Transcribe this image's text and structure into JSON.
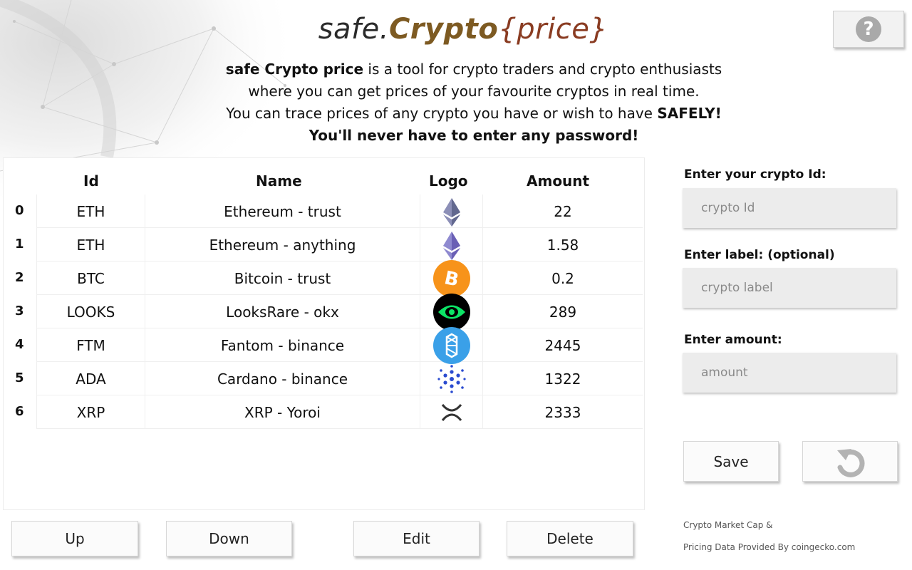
{
  "app": {
    "title_part1": "safe.",
    "title_part2": "Crypto",
    "title_part3": "{price}"
  },
  "intro": {
    "line1_bold": "safe Crypto price",
    "line1_rest": " is a tool for crypto traders and crypto enthusiasts",
    "line2": "where you can get prices of your favourite cryptos in real time.",
    "line3_rest": "You can trace prices of any crypto you have or wish to have ",
    "line3_bold": "SAFELY!",
    "line4": "You'll never have to enter any password!"
  },
  "help_button": {
    "label": "?"
  },
  "table": {
    "headers": {
      "id": "Id",
      "name": "Name",
      "logo": "Logo",
      "amount": "Amount"
    },
    "rows": [
      {
        "index": "0",
        "id": "ETH",
        "name": "Ethereum - trust",
        "logo": "ethereum-icon",
        "amount": "22"
      },
      {
        "index": "1",
        "id": "ETH",
        "name": "Ethereum - anything",
        "logo": "ethereum-icon",
        "amount": "1.58"
      },
      {
        "index": "2",
        "id": "BTC",
        "name": "Bitcoin - trust",
        "logo": "bitcoin-icon",
        "amount": "0.2"
      },
      {
        "index": "3",
        "id": "LOOKS",
        "name": "LooksRare - okx",
        "logo": "looksrare-icon",
        "amount": "289"
      },
      {
        "index": "4",
        "id": "FTM",
        "name": "Fantom - binance",
        "logo": "fantom-icon",
        "amount": "2445"
      },
      {
        "index": "5",
        "id": "ADA",
        "name": "Cardano - binance",
        "logo": "cardano-icon",
        "amount": "1322"
      },
      {
        "index": "6",
        "id": "XRP",
        "name": "XRP - Yoroi",
        "logo": "xrp-icon",
        "amount": "2333"
      }
    ]
  },
  "buttons": {
    "up": "Up",
    "down": "Down",
    "edit": "Edit",
    "delete": "Delete",
    "save": "Save",
    "undo_icon": "undo-icon"
  },
  "form": {
    "id_label": "Enter your crypto Id:",
    "id_placeholder": "crypto Id",
    "label_label": "Enter label: (optional)",
    "label_placeholder": "crypto label",
    "amount_label": "Enter amount:",
    "amount_placeholder": "amount"
  },
  "footer": {
    "line1": "Crypto Market Cap &",
    "line2": "Pricing Data Provided By coingecko.com"
  },
  "colors": {
    "bitcoin": "#f7931a",
    "looksrare": "#0ce466",
    "fantom": "#1969ff",
    "cardano": "#0033ad",
    "ethereum": "#627eea"
  }
}
